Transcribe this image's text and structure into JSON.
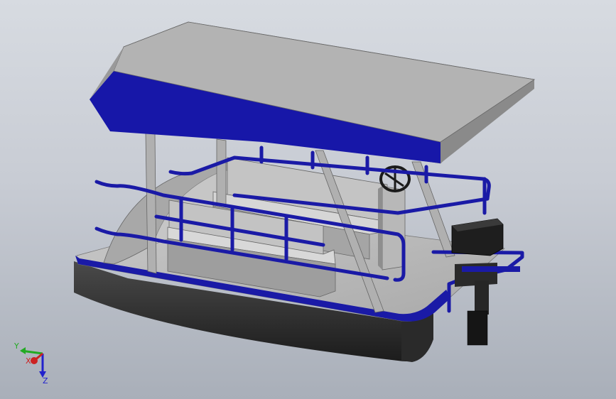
{
  "colors": {
    "background_top": "#d7dbe1",
    "background_bottom": "#a9afb9",
    "canopy_top": "#b5b5b5",
    "canopy_trim": "#1717a8",
    "rail": "#1a1aa6",
    "hull": "#3a3a3a",
    "deck": "#bcbcbc",
    "motor": "#1e1e1e"
  },
  "triad": {
    "x_label": "X",
    "y_label": "Y",
    "z_label": "Z",
    "x_color": "#cc2222",
    "y_color": "#22aa22",
    "z_color": "#2222cc"
  }
}
